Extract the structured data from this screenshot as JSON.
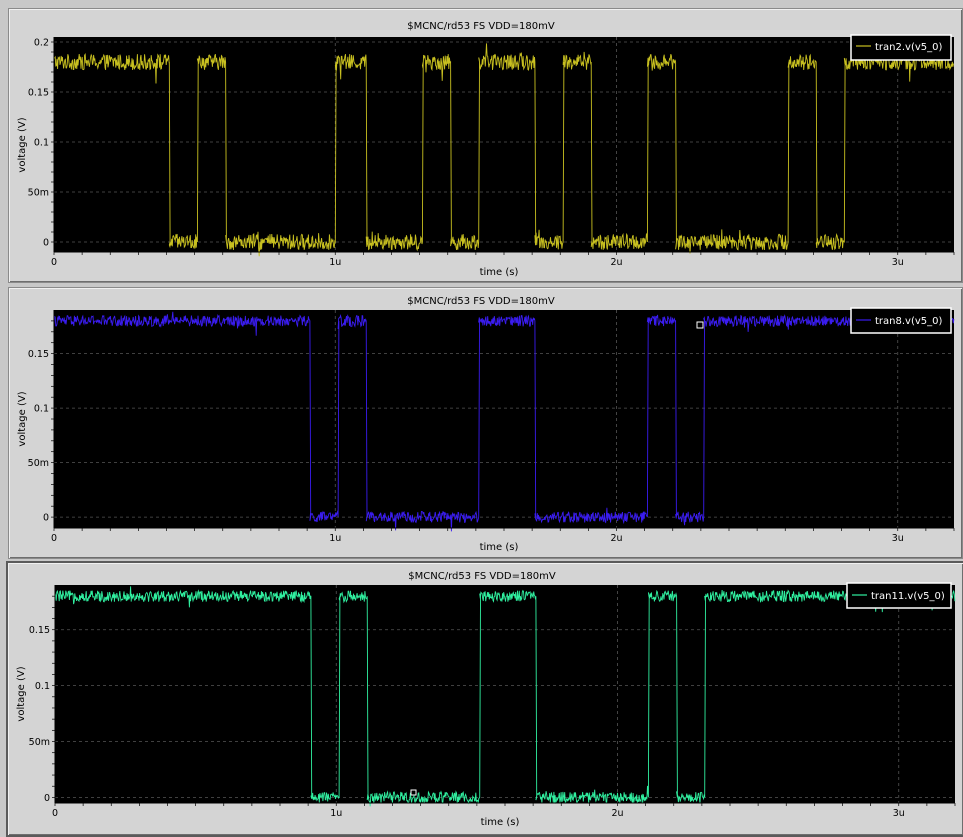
{
  "chart_data": [
    {
      "type": "line",
      "title": "$MCNC/rd53 FS VDD=180mV",
      "xlabel": "time (s)",
      "ylabel": "voltage (V)",
      "xlim": [
        0,
        3.2e-06
      ],
      "ylim": [
        -0.01,
        0.205
      ],
      "x_ticks": [
        "0",
        "1u",
        "2u",
        "3u"
      ],
      "y_ticks": [
        "0",
        "50m",
        "0.1",
        "0.15",
        "0.2"
      ],
      "grid": true,
      "legend_position": "top-right",
      "series": [
        {
          "name": "tran2.v(v5_0)",
          "color": "#c8c020",
          "high_level": 0.18,
          "low_level": 0.0,
          "noise": 0.008,
          "transitions": [
            [
              0.0,
              1
            ],
            [
              0.41,
              0
            ],
            [
              0.51,
              1
            ],
            [
              0.61,
              0
            ],
            [
              1.0,
              1
            ],
            [
              1.11,
              0
            ],
            [
              1.31,
              1
            ],
            [
              1.41,
              0
            ],
            [
              1.51,
              1
            ],
            [
              1.71,
              0
            ],
            [
              1.81,
              1
            ],
            [
              1.91,
              0
            ],
            [
              2.11,
              1
            ],
            [
              2.21,
              0
            ],
            [
              2.61,
              1
            ],
            [
              2.71,
              0
            ],
            [
              2.81,
              1
            ],
            [
              3.2,
              1
            ]
          ]
        }
      ]
    },
    {
      "type": "line",
      "title": "$MCNC/rd53 FS VDD=180mV",
      "xlabel": "time (s)",
      "ylabel": "voltage (V)",
      "xlim": [
        0,
        3.2e-06
      ],
      "ylim": [
        -0.01,
        0.19
      ],
      "x_ticks": [
        "0",
        "1u",
        "2u",
        "3u"
      ],
      "y_ticks": [
        "0",
        "50m",
        "0.1",
        "0.15"
      ],
      "grid": true,
      "legend_position": "top-right",
      "series": [
        {
          "name": "tran8.v(v5_0)",
          "color": "#3a1cf0",
          "high_level": 0.18,
          "low_level": 0.0,
          "noise": 0.005,
          "transitions": [
            [
              0.0,
              1
            ],
            [
              0.91,
              0
            ],
            [
              1.01,
              1
            ],
            [
              1.11,
              0
            ],
            [
              1.51,
              1
            ],
            [
              1.71,
              0
            ],
            [
              2.11,
              1
            ],
            [
              2.21,
              0
            ],
            [
              2.31,
              1
            ],
            [
              3.2,
              1
            ]
          ]
        }
      ]
    },
    {
      "type": "line",
      "title": "$MCNC/rd53 FS VDD=180mV",
      "xlabel": "time (s)",
      "ylabel": "voltage (V)",
      "xlim": [
        0,
        3.2e-06
      ],
      "ylim": [
        -0.005,
        0.19
      ],
      "x_ticks": [
        "0",
        "1u",
        "2u",
        "3u"
      ],
      "y_ticks": [
        "0",
        "50m",
        "0.1",
        "0.15"
      ],
      "grid": true,
      "legend_position": "top-right",
      "series": [
        {
          "name": "tran11.v(v5_0)",
          "color": "#30f0a0",
          "high_level": 0.18,
          "low_level": 0.0,
          "noise": 0.005,
          "transitions": [
            [
              0.0,
              1
            ],
            [
              0.91,
              0
            ],
            [
              1.01,
              1
            ],
            [
              1.11,
              0
            ],
            [
              1.51,
              1
            ],
            [
              1.71,
              0
            ],
            [
              2.11,
              1
            ],
            [
              2.21,
              0
            ],
            [
              2.31,
              1
            ],
            [
              3.2,
              1
            ]
          ]
        }
      ]
    }
  ]
}
